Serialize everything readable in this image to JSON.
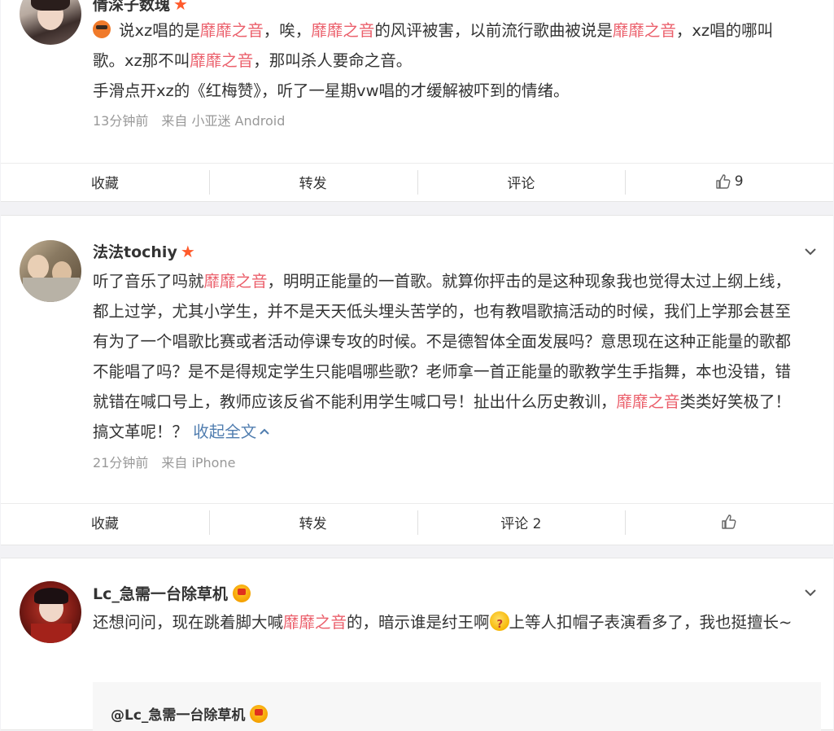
{
  "posts": [
    {
      "username": "倩深子数瑰",
      "content_lines": [
        [
          {
            "t": "说xz唱的是"
          },
          {
            "t": "靡靡之音",
            "hl": true
          },
          {
            "t": "，唉，"
          },
          {
            "t": "靡靡之音",
            "hl": true
          },
          {
            "t": "的风评被害，以前流行歌曲被说是"
          },
          {
            "t": "靡靡之音",
            "hl": true
          },
          {
            "t": "，xz唱的哪叫歌。xz那不叫"
          },
          {
            "t": "靡靡之音",
            "hl": true
          },
          {
            "t": "，那叫杀人要命之音。"
          }
        ],
        [
          {
            "t": "手滑点开xz的《红梅赞》，听了一星期vw唱的才缓解被吓到的情绪。"
          }
        ]
      ],
      "meta": "13分钟前　来自 小亚迷 Android",
      "actions": {
        "favorite": "收藏",
        "repost": "转发",
        "comment": "评论",
        "like_count": "9"
      }
    },
    {
      "username": "法法tochiy",
      "content_lines": [
        [
          {
            "t": "听了音乐了吗就"
          },
          {
            "t": "靡靡之音",
            "hl": true
          },
          {
            "t": "，明明正能量的一首歌。就算你抨击的是这种现象我也觉得太过上纲上线，都上过学，尤其小学生，并不是天天低头埋头苦学的，也有教唱歌搞活动的时候，我们上学那会甚至有为了一个唱歌比赛或者活动停课专攻的时候。不是德智体全面发展吗？意思现在这种正能量的歌都不能唱了吗？是不是得规定学生只能唱哪些歌？老师拿一首正能量的歌教学生手指舞，本也没错，错就错在喊口号上，教师应该反省不能利用学生喊口号！扯出什么历史教训，"
          },
          {
            "t": "靡靡之音",
            "hl": true
          },
          {
            "t": "类类好笑极了！搞文革呢！？ "
          },
          {
            "t": "收起全文",
            "link": true
          }
        ]
      ],
      "meta": "21分钟前　来自 iPhone",
      "actions": {
        "favorite": "收藏",
        "repost": "转发",
        "comment": "评论 2",
        "like_count": ""
      }
    },
    {
      "username": "Lc_急需一台除草机",
      "content_lines": [
        [
          {
            "t": "还想问问，现在跳着脚大喊"
          },
          {
            "t": "靡靡之音",
            "hl": true
          },
          {
            "t": "的，暗示谁是纣王啊"
          },
          {
            "emoji": "doubt-emoji"
          },
          {
            "t": "上等人扣帽子表演看多了，我也挺擅长~"
          }
        ]
      ],
      "quote_username": "@Lc_急需一台除草机"
    }
  ]
}
